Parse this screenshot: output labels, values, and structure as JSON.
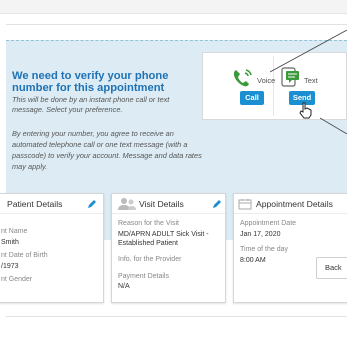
{
  "verify": {
    "title": "We need to verify your phone number for this appointment",
    "subtitle": "This will be done by an instant phone call or text message. Select your preference.",
    "consent": "By entering your number, you agree to receive an automated telephone call or one text message (with a passcode) to verify your account. Message and data rates may apply.",
    "voice": {
      "label": "Voice",
      "button": "Call",
      "icon": "phone-ringing-icon"
    },
    "text": {
      "label": "Text",
      "button": "Send",
      "icon": "text-message-icon"
    },
    "colors": {
      "accent": "#1a8fd1",
      "title": "#1e72b5",
      "panel": "#ddecf4"
    }
  },
  "patient_card": {
    "title": "Patient Details",
    "name_label": "nt Name",
    "name_value": "Smith",
    "dob_label": "nt Date of Birth",
    "dob_value": "/1973",
    "gender_label": "nt Gender"
  },
  "visit_card": {
    "title": "Visit Details",
    "reason_label": "Reason for the Visit",
    "reason_value": "MD/APRN ADULT Sick Visit - Established Patient",
    "provider_label": "Info. for the Provider",
    "payment_label": "Payment Details",
    "payment_value": "N/A"
  },
  "appointment_card": {
    "title": "Appointment Details",
    "date_label": "Appointment Date",
    "date_value": "Jan 17, 2020",
    "time_label": "Time of the day",
    "time_value": "8:00 AM"
  },
  "nav": {
    "back_label": "Back"
  }
}
